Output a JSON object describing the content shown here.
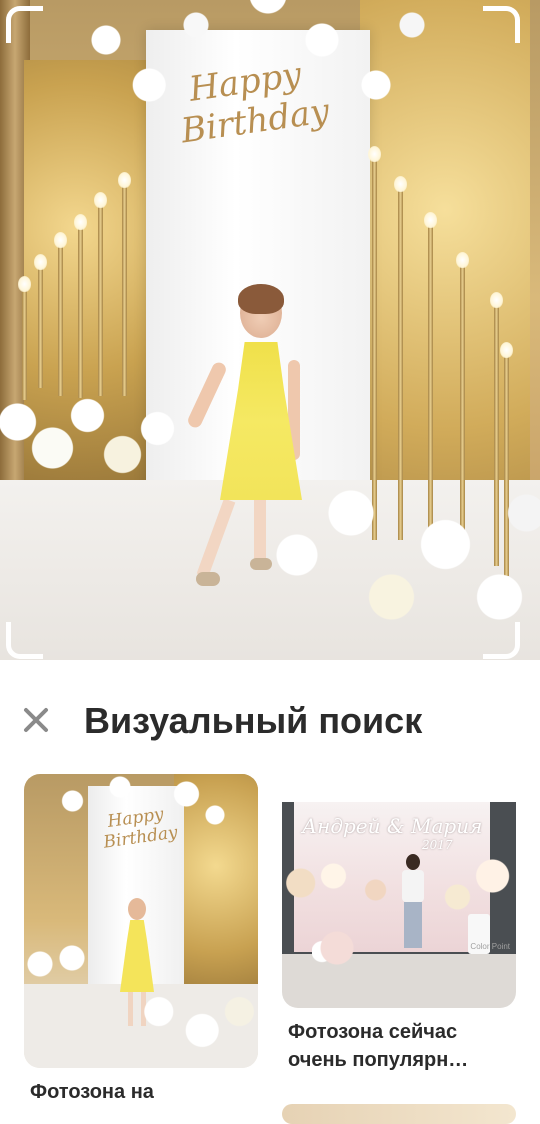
{
  "hero": {
    "image_alt": "Girl in yellow dress at Happy Birthday photo zone",
    "sign_text": "Happy Birthday"
  },
  "header": {
    "close_icon": "close-icon",
    "title": "Визуальный поиск"
  },
  "results": [
    {
      "title": "Фотозона на",
      "image_sign": "Happy Birthday"
    },
    {
      "title_line1": "Фотозона сейчас",
      "title_line2": "очень популярн…",
      "image_names": "Андрей & Мария",
      "image_year": "2017",
      "image_credit": "Color Point"
    },
    {
      "title": ""
    }
  ],
  "colors": {
    "title_text": "#2b2b2b",
    "close_icon": "#8a8a8a",
    "background": "#ffffff"
  }
}
